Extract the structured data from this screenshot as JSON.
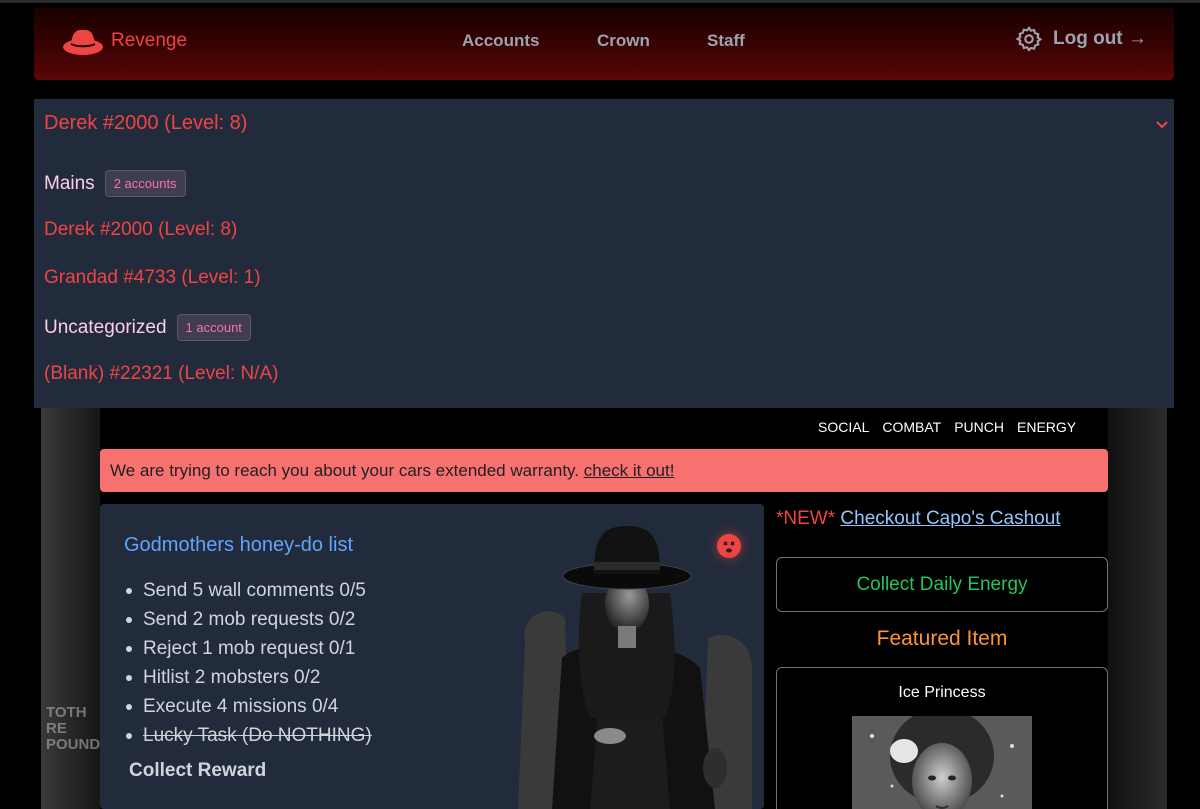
{
  "brand": {
    "name": "Revenge",
    "accent": "#ef4444"
  },
  "nav": {
    "links": [
      "Accounts",
      "Crown",
      "Staff"
    ],
    "logout": "Log out →"
  },
  "account_switcher": {
    "selected": "Derek #2000 (Level: 8)",
    "groups": [
      {
        "label": "Mains",
        "badge": "2 accounts",
        "accounts": [
          "Derek #2000 (Level: 8)",
          "Grandad #4733 (Level: 1)"
        ]
      },
      {
        "label": "Uncategorized",
        "badge": "1 account",
        "accounts": [
          "(Blank) #22321 (Level: N/A)"
        ]
      }
    ]
  },
  "stat_links": [
    "SOCIAL",
    "COMBAT",
    "PUNCH",
    "ENERGY"
  ],
  "alert": {
    "text": "We are trying to reach you about your cars extended warranty. ",
    "link": "check it out!",
    "color": "#f87171"
  },
  "task_card": {
    "title": "Godmothers honey-do list",
    "tasks": [
      {
        "text": "Send 5 wall comments 0/5",
        "done": false
      },
      {
        "text": "Send 2 mob requests 0/2",
        "done": false
      },
      {
        "text": "Reject 1 mob request 0/1",
        "done": false
      },
      {
        "text": "Hitlist 2 mobsters 0/2",
        "done": false
      },
      {
        "text": "Execute 4 missions 0/4",
        "done": false
      },
      {
        "text": "Lucky Task (Do NOTHING)",
        "done": true
      }
    ],
    "collect_label": "Collect Reward"
  },
  "promo": {
    "tag": "*NEW*",
    "link": "Checkout Capo's Cashout"
  },
  "energy_button": "Collect Daily Energy",
  "featured": {
    "title": "Featured Item",
    "item_name": "Ice Princess"
  }
}
